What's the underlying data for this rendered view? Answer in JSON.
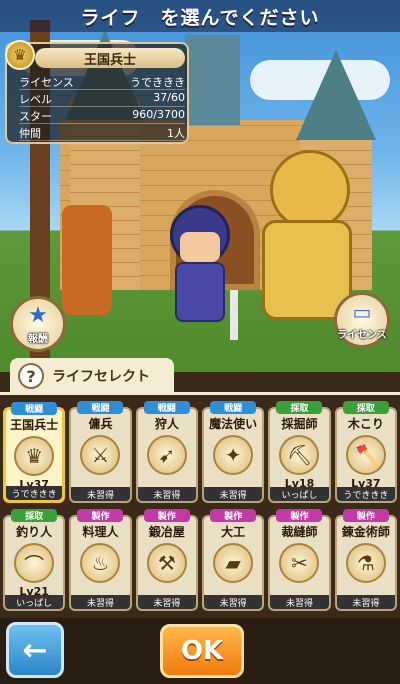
{
  "header": {
    "title": "ライフ　を選んでください"
  },
  "info_card": {
    "job_name": "王国兵士",
    "stats": [
      {
        "label": "ライセンス",
        "value": "うでききき"
      },
      {
        "label": "レベル",
        "value": "37/60"
      },
      {
        "label": "スター",
        "value": "960/3700"
      },
      {
        "label": "仲間",
        "value": "1人"
      }
    ]
  },
  "side_buttons": {
    "reward": "報酬",
    "license": "ライセンス"
  },
  "life_select": {
    "title": "ライフセレクト",
    "help_icon": "?"
  },
  "categories": {
    "battle": "戦闘",
    "gather": "採取",
    "craft": "製作"
  },
  "colors": {
    "battle": "#2f8fd6",
    "gather": "#3aa03a",
    "craft": "#c23aa6",
    "selected": "#f2c43a"
  },
  "jobs": [
    {
      "cat": "戦闘",
      "name": "王国兵士",
      "icon": "crown-icon",
      "glyph": "♛",
      "level": "Lv37",
      "status": "うでききき",
      "selected": true
    },
    {
      "cat": "戦闘",
      "name": "傭兵",
      "icon": "sword-icon",
      "glyph": "⚔",
      "level": "",
      "status": "未習得",
      "selected": false
    },
    {
      "cat": "戦闘",
      "name": "狩人",
      "icon": "bow-icon",
      "glyph": "➹",
      "level": "",
      "status": "未習得",
      "selected": false
    },
    {
      "cat": "戦闘",
      "name": "魔法使い",
      "icon": "wand-icon",
      "glyph": "✦",
      "level": "",
      "status": "未習得",
      "selected": false
    },
    {
      "cat": "採取",
      "name": "採掘師",
      "icon": "pickaxe-icon",
      "glyph": "⛏",
      "level": "Lv18",
      "status": "いっぱし",
      "selected": false
    },
    {
      "cat": "採取",
      "name": "木こり",
      "icon": "axe-icon",
      "glyph": "🪓",
      "level": "Lv37",
      "status": "うでききき",
      "selected": false
    },
    {
      "cat": "採取",
      "name": "釣り人",
      "icon": "fishing-rod-icon",
      "glyph": "⌒",
      "level": "Lv21",
      "status": "いっぱし",
      "selected": false
    },
    {
      "cat": "製作",
      "name": "料理人",
      "icon": "ladle-icon",
      "glyph": "♨",
      "level": "",
      "status": "未習得",
      "selected": false
    },
    {
      "cat": "製作",
      "name": "鍛冶屋",
      "icon": "hammer-icon",
      "glyph": "⚒",
      "level": "",
      "status": "未習得",
      "selected": false
    },
    {
      "cat": "製作",
      "name": "大工",
      "icon": "saw-icon",
      "glyph": "▰",
      "level": "",
      "status": "未習得",
      "selected": false
    },
    {
      "cat": "製作",
      "name": "裁縫師",
      "icon": "needle-icon",
      "glyph": "✂",
      "level": "",
      "status": "未習得",
      "selected": false
    },
    {
      "cat": "製作",
      "name": "錬金術師",
      "icon": "flask-icon",
      "glyph": "⚗",
      "level": "",
      "status": "未習得",
      "selected": false
    }
  ],
  "buttons": {
    "back": "←",
    "ok": "OK"
  }
}
